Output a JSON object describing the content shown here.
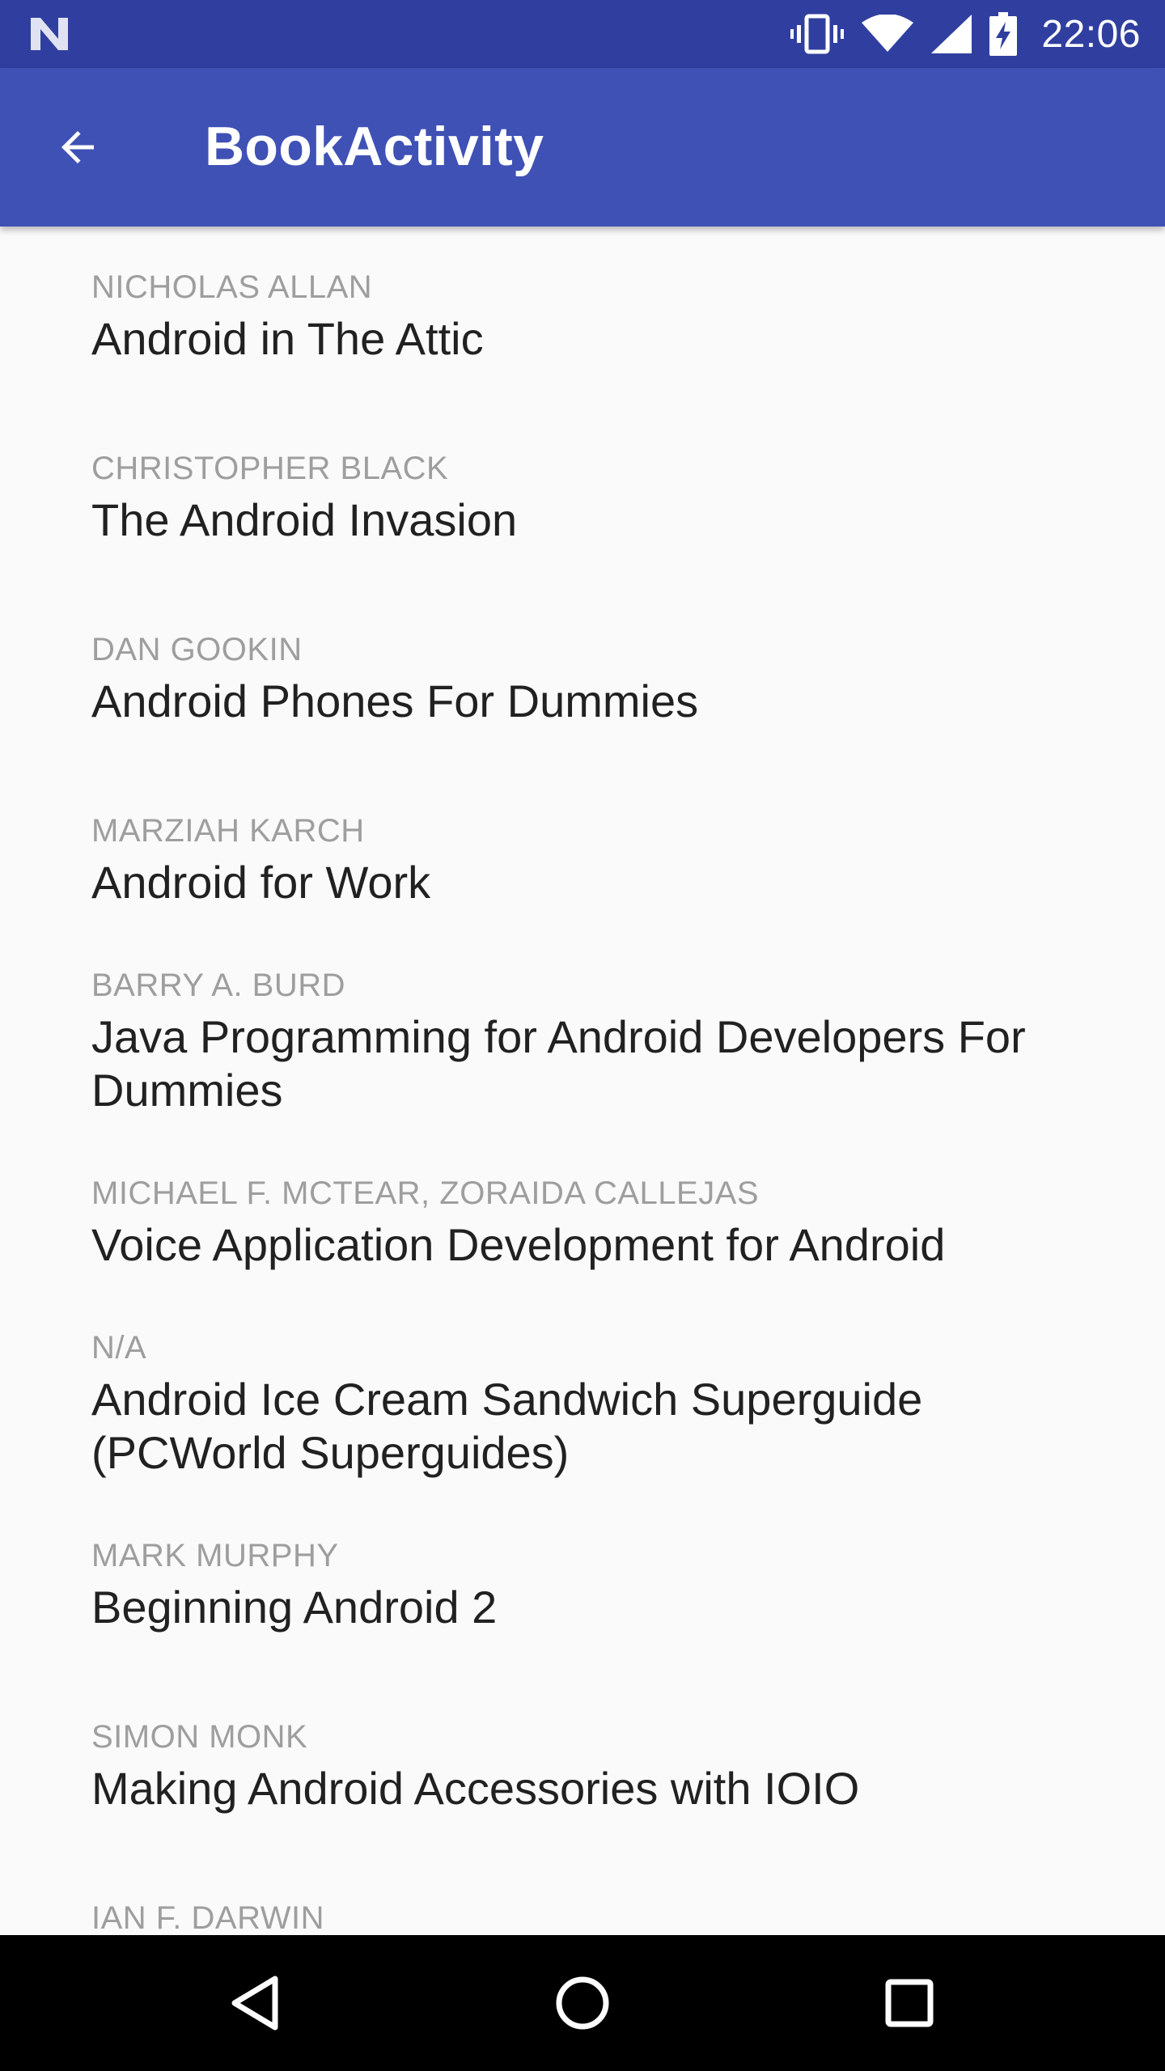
{
  "status_bar": {
    "time": "22:06",
    "icons": [
      "notification-n-icon",
      "vibrate-icon",
      "wifi-icon",
      "cell-signal-icon",
      "battery-charging-icon"
    ]
  },
  "app_bar": {
    "title": "BookActivity",
    "back_icon": "arrow-back-icon",
    "color": "#3f51b5",
    "status_color": "#303f9f"
  },
  "books": [
    {
      "author": "Nicholas Allan",
      "title": "Android in The Attic"
    },
    {
      "author": "Christopher Black",
      "title": "The Android Invasion"
    },
    {
      "author": "Dan Gookin",
      "title": "Android Phones For Dummies"
    },
    {
      "author": "Marziah Karch",
      "title": "Android for Work"
    },
    {
      "author": "Barry A. Burd",
      "title": "Java Programming for Android Developers For Dummies"
    },
    {
      "author": "Michael F. McTear, Zoraida Callejas",
      "title": "Voice Application Development for Android"
    },
    {
      "author": "N/A",
      "title": "Android Ice Cream Sandwich Superguide (PCWorld Superguides)"
    },
    {
      "author": "Mark Murphy",
      "title": "Beginning Android 2"
    },
    {
      "author": "Simon Monk",
      "title": "Making Android Accessories with IOIO"
    },
    {
      "author": "Ian F. Darwin",
      "title": ""
    }
  ],
  "nav_bar": {
    "icons": [
      "back-triangle-icon",
      "home-circle-icon",
      "recents-square-icon"
    ]
  }
}
